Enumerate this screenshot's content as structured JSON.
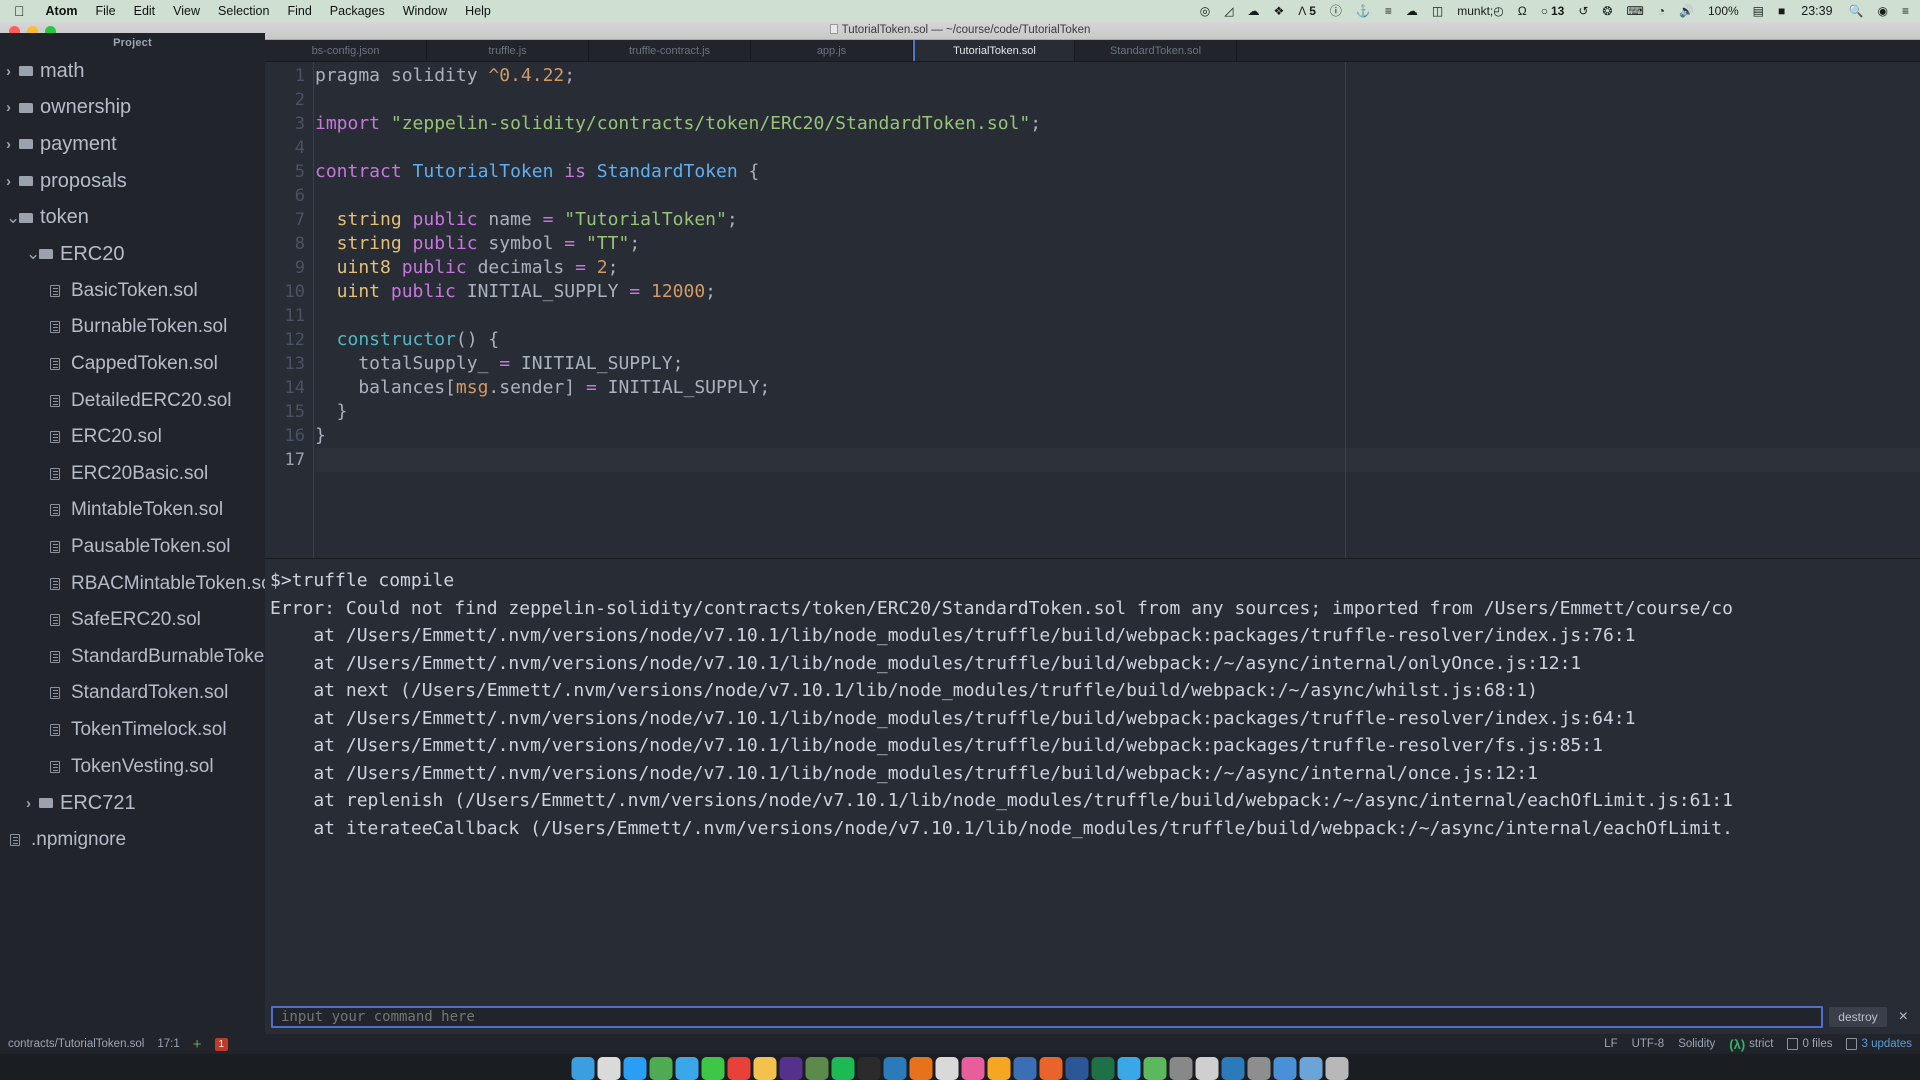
{
  "menubar": {
    "apple": "apple-logo",
    "items": [
      "Atom",
      "File",
      "Edit",
      "View",
      "Selection",
      "Find",
      "Packages",
      "Window",
      "Help"
    ],
    "tray": [
      {
        "name": "record-icon",
        "glyph": "◉",
        "count": ""
      },
      {
        "name": "evernote-icon",
        "glyph": "◗",
        "count": ""
      },
      {
        "name": "cloud-icon",
        "glyph": "☁",
        "count": ""
      },
      {
        "name": "dropbox-icon",
        "glyph": "❖",
        "count": ""
      },
      {
        "name": "tunnelblick-icon",
        "glyph": "Λ",
        "count": "5"
      },
      {
        "name": "clock-circle-icon",
        "glyph": "ⓘ",
        "count": ""
      },
      {
        "name": "docker-icon",
        "glyph": "⚓",
        "count": ""
      },
      {
        "name": "layers-icon",
        "glyph": "≡",
        "count": ""
      },
      {
        "name": "cloudapp-icon",
        "glyph": "☁",
        "count": ""
      },
      {
        "name": "divvy-icon",
        "glyph": "◫",
        "count": ""
      },
      {
        "name": "timer-icon",
        "glyph": "◴",
        "count": ""
      },
      {
        "name": "headphones-icon",
        "glyph": "Ω",
        "count": ""
      },
      {
        "name": "notification-icon",
        "glyph": "○",
        "count": "13"
      },
      {
        "name": "time-machine-icon",
        "glyph": "↺",
        "count": ""
      },
      {
        "name": "bluetooth-icon",
        "glyph": "✲",
        "count": ""
      },
      {
        "name": "keyboard-icon",
        "glyph": "⌨",
        "count": ""
      },
      {
        "name": "wifi-icon",
        "glyph": "◔",
        "count": ""
      },
      {
        "name": "volume-icon",
        "glyph": "🔊",
        "count": ""
      }
    ],
    "battery_percent": "100%",
    "flag": "us-flag-icon",
    "clock": "23:39",
    "search": "spotlight-search-icon",
    "siri": "siri-icon",
    "control_center": "notification-center-icon"
  },
  "window": {
    "title": "TutorialToken.sol — ~/course/code/TutorialToken"
  },
  "sidebar": {
    "header": "Project",
    "items": [
      {
        "label": "math",
        "type": "folder",
        "depth": 0,
        "expanded": false
      },
      {
        "label": "ownership",
        "type": "folder",
        "depth": 0,
        "expanded": false
      },
      {
        "label": "payment",
        "type": "folder",
        "depth": 0,
        "expanded": false
      },
      {
        "label": "proposals",
        "type": "folder",
        "depth": 0,
        "expanded": false
      },
      {
        "label": "token",
        "type": "folder",
        "depth": 0,
        "expanded": true
      },
      {
        "label": "ERC20",
        "type": "folder",
        "depth": 1,
        "expanded": true
      },
      {
        "label": "BasicToken.sol",
        "type": "file",
        "depth": 2
      },
      {
        "label": "BurnableToken.sol",
        "type": "file",
        "depth": 2
      },
      {
        "label": "CappedToken.sol",
        "type": "file",
        "depth": 2
      },
      {
        "label": "DetailedERC20.sol",
        "type": "file",
        "depth": 2
      },
      {
        "label": "ERC20.sol",
        "type": "file",
        "depth": 2
      },
      {
        "label": "ERC20Basic.sol",
        "type": "file",
        "depth": 2
      },
      {
        "label": "MintableToken.sol",
        "type": "file",
        "depth": 2
      },
      {
        "label": "PausableToken.sol",
        "type": "file",
        "depth": 2
      },
      {
        "label": "RBACMintableToken.sol",
        "type": "file",
        "depth": 2
      },
      {
        "label": "SafeERC20.sol",
        "type": "file",
        "depth": 2
      },
      {
        "label": "StandardBurnableToken.sol",
        "type": "file",
        "depth": 2
      },
      {
        "label": "StandardToken.sol",
        "type": "file",
        "depth": 2
      },
      {
        "label": "TokenTimelock.sol",
        "type": "file",
        "depth": 2
      },
      {
        "label": "TokenVesting.sol",
        "type": "file",
        "depth": 2
      },
      {
        "label": "ERC721",
        "type": "folder",
        "depth": 1,
        "expanded": false
      },
      {
        "label": ".npmignore",
        "type": "file",
        "depth": 0
      }
    ]
  },
  "tabs": [
    {
      "label": "bs-config.json",
      "active": false
    },
    {
      "label": "truffle.js",
      "active": false
    },
    {
      "label": "truffle-contract.js",
      "active": false
    },
    {
      "label": "app.js",
      "active": false
    },
    {
      "label": "TutorialToken.sol",
      "active": true
    },
    {
      "label": "StandardToken.sol",
      "active": false
    }
  ],
  "editor": {
    "line_numbers": [
      "1",
      "2",
      "3",
      "4",
      "5",
      "6",
      "7",
      "8",
      "9",
      "10",
      "11",
      "12",
      "13",
      "14",
      "15",
      "16",
      "17"
    ],
    "cursor_line": 17,
    "lines": [
      [
        {
          "t": "pragma solidity ",
          "c": "k-plain"
        },
        {
          "t": "^0.4.22",
          "c": "k-num"
        },
        {
          "t": ";",
          "c": "k-punc"
        }
      ],
      [],
      [
        {
          "t": "import ",
          "c": "k-kw"
        },
        {
          "t": "\"zeppelin-solidity/contracts/token/ERC20/StandardToken.sol\"",
          "c": "k-str"
        },
        {
          "t": ";",
          "c": "k-punc"
        }
      ],
      [],
      [
        {
          "t": "contract ",
          "c": "k-kw"
        },
        {
          "t": "TutorialToken",
          "c": "k-cls"
        },
        {
          "t": " is ",
          "c": "k-kw"
        },
        {
          "t": "StandardToken",
          "c": "k-cls"
        },
        {
          "t": " {",
          "c": "k-punc"
        }
      ],
      [],
      [
        {
          "t": "  string",
          "c": "k-type"
        },
        {
          "t": " ",
          "c": "k-plain"
        },
        {
          "t": "public",
          "c": "k-kw"
        },
        {
          "t": " name ",
          "c": "k-plain"
        },
        {
          "t": "=",
          "c": "k-kw"
        },
        {
          "t": " ",
          "c": "k-plain"
        },
        {
          "t": "\"TutorialToken\"",
          "c": "k-str"
        },
        {
          "t": ";",
          "c": "k-punc"
        }
      ],
      [
        {
          "t": "  string",
          "c": "k-type"
        },
        {
          "t": " ",
          "c": "k-plain"
        },
        {
          "t": "public",
          "c": "k-kw"
        },
        {
          "t": " symbol ",
          "c": "k-plain"
        },
        {
          "t": "=",
          "c": "k-kw"
        },
        {
          "t": " ",
          "c": "k-plain"
        },
        {
          "t": "\"TT\"",
          "c": "k-str"
        },
        {
          "t": ";",
          "c": "k-punc"
        }
      ],
      [
        {
          "t": "  uint8",
          "c": "k-type"
        },
        {
          "t": " ",
          "c": "k-plain"
        },
        {
          "t": "public",
          "c": "k-kw"
        },
        {
          "t": " decimals ",
          "c": "k-plain"
        },
        {
          "t": "=",
          "c": "k-kw"
        },
        {
          "t": " ",
          "c": "k-plain"
        },
        {
          "t": "2",
          "c": "k-num"
        },
        {
          "t": ";",
          "c": "k-punc"
        }
      ],
      [
        {
          "t": "  uint",
          "c": "k-type"
        },
        {
          "t": " ",
          "c": "k-plain"
        },
        {
          "t": "public",
          "c": "k-kw"
        },
        {
          "t": " INITIAL_SUPPLY ",
          "c": "k-plain"
        },
        {
          "t": "=",
          "c": "k-kw"
        },
        {
          "t": " ",
          "c": "k-plain"
        },
        {
          "t": "12000",
          "c": "k-num"
        },
        {
          "t": ";",
          "c": "k-punc"
        }
      ],
      [],
      [
        {
          "t": "  constructor",
          "c": "k-fn"
        },
        {
          "t": "() {",
          "c": "k-punc"
        }
      ],
      [
        {
          "t": "    totalSupply_ ",
          "c": "k-plain"
        },
        {
          "t": "=",
          "c": "k-kw"
        },
        {
          "t": " INITIAL_SUPPLY;",
          "c": "k-plain"
        }
      ],
      [
        {
          "t": "    balances[",
          "c": "k-plain"
        },
        {
          "t": "msg",
          "c": "k-num"
        },
        {
          "t": ".sender",
          "c": "k-plain"
        },
        {
          "t": "]",
          "c": "k-plain"
        },
        {
          "t": " ",
          "c": "k-plain"
        },
        {
          "t": "=",
          "c": "k-kw"
        },
        {
          "t": " INITIAL_SUPPLY;",
          "c": "k-plain"
        }
      ],
      [
        {
          "t": "  }",
          "c": "k-punc"
        }
      ],
      [
        {
          "t": "}",
          "c": "k-punc"
        }
      ],
      []
    ]
  },
  "terminal": {
    "lines": [
      "$>truffle compile",
      "Error: Could not find zeppelin-solidity/contracts/token/ERC20/StandardToken.sol from any sources; imported from /Users/Emmett/course/co",
      "    at /Users/Emmett/.nvm/versions/node/v7.10.1/lib/node_modules/truffle/build/webpack:packages/truffle-resolver/index.js:76:1",
      "    at /Users/Emmett/.nvm/versions/node/v7.10.1/lib/node_modules/truffle/build/webpack:/~/async/internal/onlyOnce.js:12:1",
      "    at next (/Users/Emmett/.nvm/versions/node/v7.10.1/lib/node_modules/truffle/build/webpack:/~/async/whilst.js:68:1)",
      "    at /Users/Emmett/.nvm/versions/node/v7.10.1/lib/node_modules/truffle/build/webpack:packages/truffle-resolver/index.js:64:1",
      "    at /Users/Emmett/.nvm/versions/node/v7.10.1/lib/node_modules/truffle/build/webpack:packages/truffle-resolver/fs.js:85:1",
      "    at /Users/Emmett/.nvm/versions/node/v7.10.1/lib/node_modules/truffle/build/webpack:/~/async/internal/once.js:12:1",
      "    at replenish (/Users/Emmett/.nvm/versions/node/v7.10.1/lib/node_modules/truffle/build/webpack:/~/async/internal/eachOfLimit.js:61:1",
      "    at iterateeCallback (/Users/Emmett/.nvm/versions/node/v7.10.1/lib/node_modules/truffle/build/webpack:/~/async/internal/eachOfLimit."
    ],
    "input_placeholder": "input your command here",
    "input_value": "",
    "destroy_label": "destroy",
    "close_label": "×"
  },
  "statusbar": {
    "file_path": "contracts/TutorialToken.sol",
    "cursor_position": "17:1",
    "add_glyph": "+",
    "error_count": "1",
    "line_ending": "LF",
    "encoding": "UTF-8",
    "grammar": "Solidity",
    "linter_lambda": "(λ)",
    "linter_mode": "strict",
    "git_files": "0 files",
    "updates": "3 updates"
  },
  "dock": {
    "icons": [
      {
        "name": "finder-icon",
        "color": "#3a9ee0"
      },
      {
        "name": "launchpad-icon",
        "color": "#dadada"
      },
      {
        "name": "safari-icon",
        "color": "#2a9df4"
      },
      {
        "name": "chrome-icon",
        "color": "#4fab52"
      },
      {
        "name": "mail-icon",
        "color": "#3aa7e8"
      },
      {
        "name": "messages-icon",
        "color": "#3ec646"
      },
      {
        "name": "calendar-icon",
        "color": "#e8413a"
      },
      {
        "name": "notes-icon",
        "color": "#f2c14e"
      },
      {
        "name": "slack-icon",
        "color": "#55318c"
      },
      {
        "name": "atom-icon",
        "color": "#5c8a4b"
      },
      {
        "name": "spotify-icon",
        "color": "#1db954"
      },
      {
        "name": "terminal-icon",
        "color": "#2b2b2b"
      },
      {
        "name": "vscode-icon",
        "color": "#2b7bbb"
      },
      {
        "name": "firefox-icon",
        "color": "#e6731b"
      },
      {
        "name": "photos-icon",
        "color": "#d9d9d9"
      },
      {
        "name": "itunes-icon",
        "color": "#e85d9c"
      },
      {
        "name": "sketch-icon",
        "color": "#f5a623"
      },
      {
        "name": "xcode-icon",
        "color": "#3b6fb5"
      },
      {
        "name": "postman-icon",
        "color": "#e8642b"
      },
      {
        "name": "word-icon",
        "color": "#2b5797"
      },
      {
        "name": "excel-icon",
        "color": "#1e7145"
      },
      {
        "name": "keynote-icon",
        "color": "#3aa7e8"
      },
      {
        "name": "numbers-icon",
        "color": "#5cb85c"
      },
      {
        "name": "robo-icon",
        "color": "#888888"
      },
      {
        "name": "music-icon",
        "color": "#cfcfcf"
      },
      {
        "name": "trello-icon",
        "color": "#2b7bbb"
      },
      {
        "name": "preferences-icon",
        "color": "#8e8e8e"
      },
      {
        "name": "downloads-icon",
        "color": "#4a90d9"
      },
      {
        "name": "folder-icon",
        "color": "#6ba5d7"
      },
      {
        "name": "trash-icon",
        "color": "#b8b8b8"
      }
    ]
  }
}
